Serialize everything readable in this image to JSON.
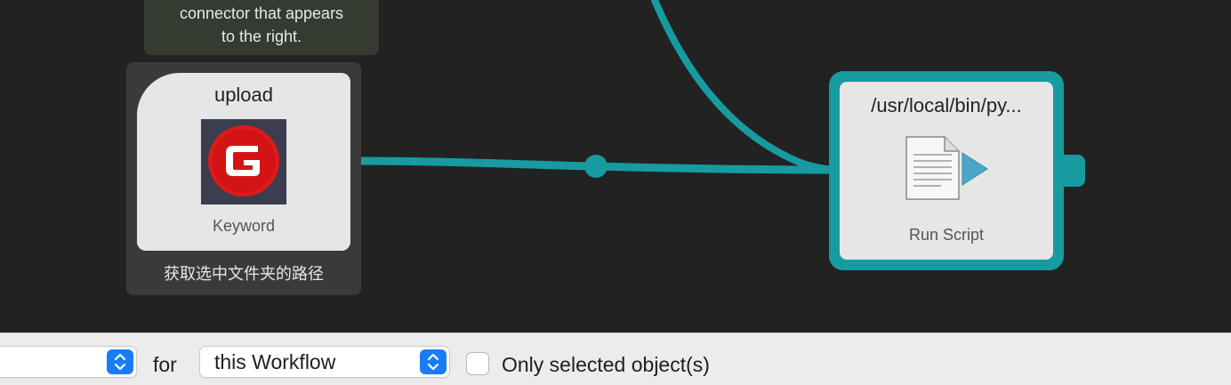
{
  "canvas": {
    "note": {
      "lines": [
        "connector that appears",
        "to the right."
      ]
    },
    "keyword_node": {
      "title": "upload",
      "type_label": "Keyword",
      "description": "获取选中文件夹的路径",
      "icon": "g-logo-icon"
    },
    "run_script_node": {
      "title": "/usr/local/bin/py...",
      "type_label": "Run Script",
      "icon": "script-document-icon"
    }
  },
  "toolbar": {
    "first_select": {
      "value": ""
    },
    "for_label": "for",
    "scope_select": {
      "value": "this Workflow"
    },
    "only_selected": {
      "label": "Only selected object(s)",
      "checked": false
    }
  },
  "colors": {
    "canvas_bg": "#222222",
    "connection": "#179ba0",
    "node_fill": "#e6e6e6",
    "note_bg": "#353b31",
    "select_accent": "#1a7cf5"
  }
}
